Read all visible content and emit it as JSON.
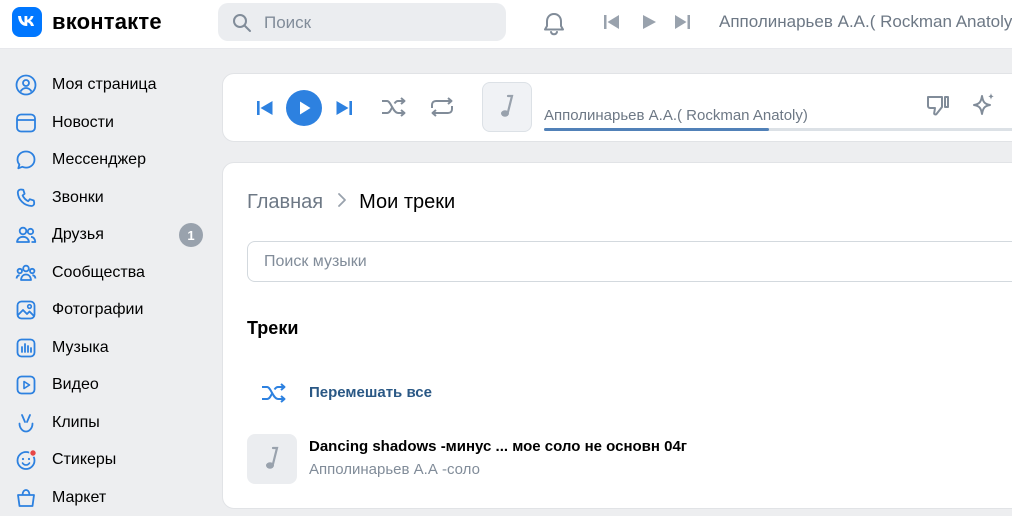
{
  "header": {
    "logo_text": "вконтакте",
    "logo_mark": "vk",
    "search_placeholder": "Поиск",
    "now_playing": "Апполинарьев А.А.( Rockman Anatoly)"
  },
  "sidebar": {
    "items": [
      {
        "label": "Моя страница",
        "icon": "user-circle-icon"
      },
      {
        "label": "Новости",
        "icon": "news-icon"
      },
      {
        "label": "Мессенджер",
        "icon": "message-icon"
      },
      {
        "label": "Звонки",
        "icon": "phone-icon"
      },
      {
        "label": "Друзья",
        "icon": "friends-icon",
        "badge": "1"
      },
      {
        "label": "Сообщества",
        "icon": "communities-icon"
      },
      {
        "label": "Фотографии",
        "icon": "photo-icon"
      },
      {
        "label": "Музыка",
        "icon": "music-icon"
      },
      {
        "label": "Видео",
        "icon": "video-icon"
      },
      {
        "label": "Клипы",
        "icon": "clips-icon"
      },
      {
        "label": "Стикеры",
        "icon": "stickers-icon"
      },
      {
        "label": "Маркет",
        "icon": "market-icon"
      }
    ]
  },
  "player": {
    "track_title": "Апполинарьев А.А.( Rockman Anatoly)",
    "progress_fraction": 0.46
  },
  "main": {
    "breadcrumb_home": "Главная",
    "breadcrumb_current": "Мои треки",
    "music_search_placeholder": "Поиск музыки",
    "section_title": "Треки",
    "shuffle_label": "Перемешать все",
    "tracks": [
      {
        "title": "Dancing shadows -минус ... мое соло не основн 04г",
        "artist": "Апполинарьев А.А -соло"
      }
    ]
  },
  "colors": {
    "accent": "#2d81e0",
    "brand": "#0077ff",
    "link": "#2a5885",
    "background": "#edeef0",
    "secondary_text": "#818c99",
    "notification_dot": "#e64646"
  }
}
